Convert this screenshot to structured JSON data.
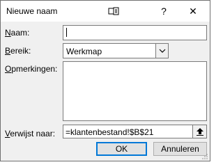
{
  "dialog": {
    "title": "Nieuwe naam",
    "help_glyph": "?",
    "close_glyph": "✕"
  },
  "fields": {
    "name": {
      "label_key": "N",
      "label_rest": "aam:",
      "value": ""
    },
    "scope": {
      "label_key": "B",
      "label_rest": "ereik:",
      "selected": "Werkmap"
    },
    "comment": {
      "label_key": "O",
      "label_rest": "pmerkingen:",
      "value": ""
    },
    "refers_to": {
      "label_key": "V",
      "label_rest": "erwijst naar:",
      "value": "=klantenbestand!$B$21"
    }
  },
  "buttons": {
    "ok": "OK",
    "cancel": "Annuleren"
  },
  "icons": {
    "resize": "resize-icon",
    "dropdown": "chevron-down-icon",
    "collapse": "collapse-dialog-icon",
    "grip": "size-grip-icon"
  }
}
